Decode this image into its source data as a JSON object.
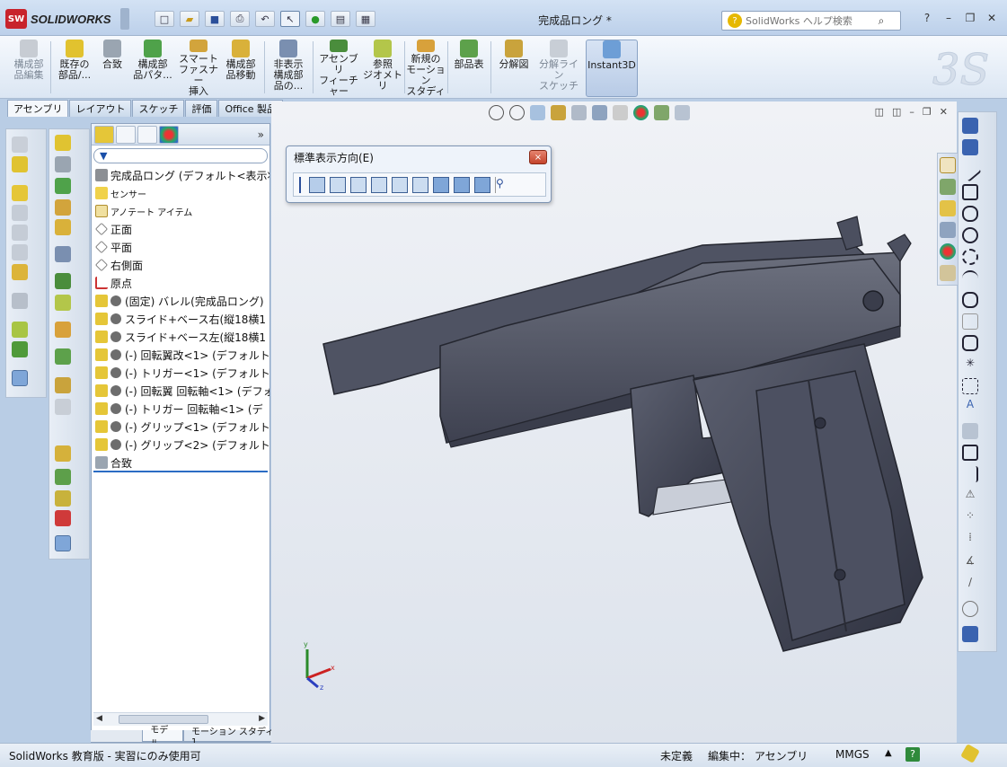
{
  "app": {
    "brand_badge": "SW",
    "brand_name": "SOLIDWORKS",
    "doc_title": "完成品ロング *"
  },
  "help": {
    "placeholder": "SolidWorks ヘルプ検索"
  },
  "ribbon": {
    "buttons": [
      {
        "l1": "構成部",
        "l2": "品編集",
        "l3": ""
      },
      {
        "l1": "既存の",
        "l2": "部品/...",
        "l3": ""
      },
      {
        "l1": "合致",
        "l2": "",
        "l3": ""
      },
      {
        "l1": "構成部",
        "l2": "品パタ...",
        "l3": ""
      },
      {
        "l1": "スマート",
        "l2": "ファスナー",
        "l3": "挿入"
      },
      {
        "l1": "構成部",
        "l2": "品移動",
        "l3": ""
      },
      {
        "l1": "非表示",
        "l2": "構成部",
        "l3": "品の..."
      },
      {
        "l1": "アセンブリ",
        "l2": "フィーチャー",
        "l3": ""
      },
      {
        "l1": "参照",
        "l2": "ジオメトリ",
        "l3": ""
      },
      {
        "l1": "新規の",
        "l2": "モーション",
        "l3": "スタディ"
      },
      {
        "l1": "部品表",
        "l2": "",
        "l3": ""
      },
      {
        "l1": "分解図",
        "l2": "",
        "l3": ""
      },
      {
        "l1": "分解ライン",
        "l2": "スケッチ",
        "l3": ""
      },
      {
        "l1": "Instant3D",
        "l2": "",
        "l3": ""
      }
    ]
  },
  "tabs": [
    "アセンブリ",
    "レイアウト",
    "スケッチ",
    "評価",
    "Office 製品"
  ],
  "tree": {
    "root": "完成品ロング (デフォルト<表示状態",
    "items": [
      "センサー",
      "アノテート アイテム",
      "正面",
      "平面",
      "右側面",
      "原点",
      "(固定) バレル(完成品ロング)",
      "スライド+ベース右(縦18横1",
      "スライド+ベース左(縦18横1",
      "(-) 回転翼改<1> (デフォルト<<",
      "(-) トリガー<1> (デフォルト<<",
      "(-) 回転翼 回転軸<1> (デフォ",
      "(-) トリガー 回転軸<1> (デ",
      "(-) グリップ<1> (デフォルト<<",
      "(-) グリップ<2> (デフォルト<<",
      "合致"
    ]
  },
  "bottom_tabs": [
    "モデル",
    "モーション スタディ 1"
  ],
  "std_views": {
    "title": "標準表示方向(E)",
    "close": "×"
  },
  "status": {
    "left": "SolidWorks 教育版 - 実習にのみ使用可",
    "state": "未定義",
    "editing": "編集中： アセンブリ",
    "units": "MMGS",
    "help": "?"
  },
  "triad": {
    "x": "x",
    "y": "y",
    "z": "z"
  }
}
